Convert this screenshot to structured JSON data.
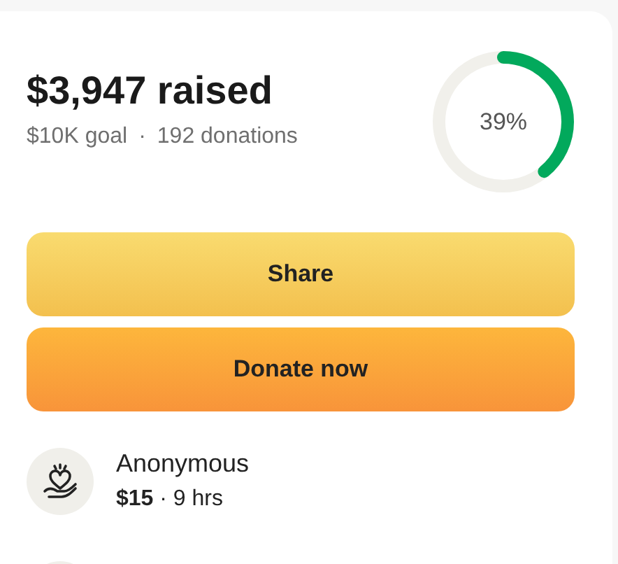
{
  "summary": {
    "raised": "$3,947 raised",
    "goal": "$10K goal",
    "separator": "·",
    "donations": "192 donations"
  },
  "progress": {
    "level": 0.39,
    "label": "39%"
  },
  "buttons": [
    {
      "label": "Share",
      "kind": "share"
    },
    {
      "label": "Donate now",
      "kind": "donate"
    }
  ],
  "donations": [
    {
      "name": "Anonymous",
      "detail": "**$15** · 9 hrs"
    }
  ]
}
